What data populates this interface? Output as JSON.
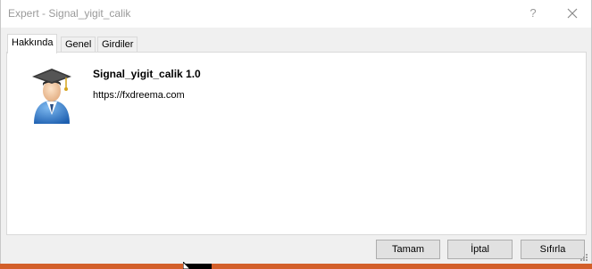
{
  "window": {
    "title": "Expert - Signal_yigit_calik",
    "help_label": "?",
    "close_icon": "close-icon"
  },
  "tabs": [
    {
      "label": "Hakkında",
      "active": true
    },
    {
      "label": "Genel",
      "active": false
    },
    {
      "label": "Girdiler",
      "active": false
    }
  ],
  "about": {
    "icon": "graduate-avatar-icon",
    "name": "Signal_yigit_calik 1.0",
    "link": "https://fxdreema.com"
  },
  "buttons": {
    "ok": "Tamam",
    "cancel": "İptal",
    "reset": "Sıfırla"
  },
  "colors": {
    "avatar_blue": "#2f7fd4",
    "cap": "#3a3a3a",
    "taskbar": "#d35f2a"
  }
}
